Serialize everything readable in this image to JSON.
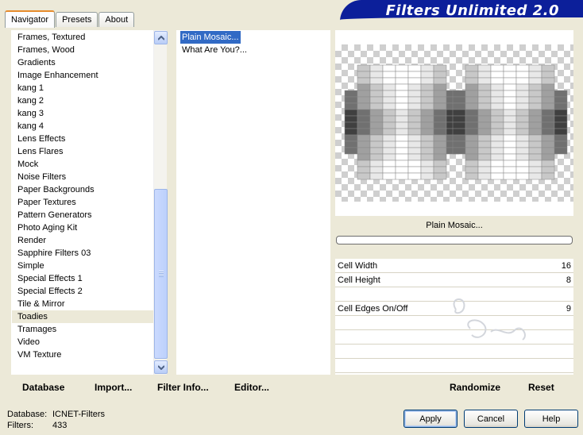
{
  "tabs": [
    {
      "label": "Navigator",
      "active": true
    },
    {
      "label": "Presets",
      "active": false
    },
    {
      "label": "About",
      "active": false
    }
  ],
  "banner": {
    "title": "Filters Unlimited 2.0",
    "color": "#0c1f9a"
  },
  "categories": {
    "items": [
      "Frames, Textured",
      "Frames, Wood",
      "Gradients",
      "Image Enhancement",
      "kang 1",
      "kang 2",
      "kang 3",
      "kang 4",
      "Lens Effects",
      "Lens Flares",
      "Mock",
      "Noise Filters",
      "Paper Backgrounds",
      "Paper Textures",
      "Pattern Generators",
      "Photo Aging Kit",
      "Render",
      "Sapphire Filters 03",
      "Simple",
      "Special Effects 1",
      "Special Effects 2",
      "Tile & Mirror",
      "Toadies",
      "Tramages",
      "Video",
      "VM Texture"
    ],
    "selected": "Toadies"
  },
  "filters": {
    "items": [
      "Plain Mosaic...",
      "What Are You?..."
    ],
    "selected": "Plain Mosaic..."
  },
  "preview": {
    "filter_label": "Plain Mosaic..."
  },
  "params": [
    {
      "label": "Cell Width",
      "value": "16"
    },
    {
      "label": "Cell Height",
      "value": "8"
    },
    {
      "label": "",
      "value": ""
    },
    {
      "label": "Cell Edges On/Off",
      "value": "9"
    },
    {
      "label": "",
      "value": ""
    },
    {
      "label": "",
      "value": ""
    },
    {
      "label": "",
      "value": ""
    },
    {
      "label": "",
      "value": ""
    }
  ],
  "toolbar": {
    "database": "Database",
    "import": "Import...",
    "filter_info": "Filter Info...",
    "editor": "Editor...",
    "randomize": "Randomize",
    "reset": "Reset"
  },
  "status": {
    "database_label": "Database:",
    "database_value": "ICNET-Filters",
    "filters_label": "Filters:",
    "filters_value": "433"
  },
  "buttons": {
    "apply": "Apply",
    "cancel": "Cancel",
    "help": "Help"
  },
  "accent": {
    "selection": "#316ac5",
    "tab_highlight": "#e68b2c"
  }
}
